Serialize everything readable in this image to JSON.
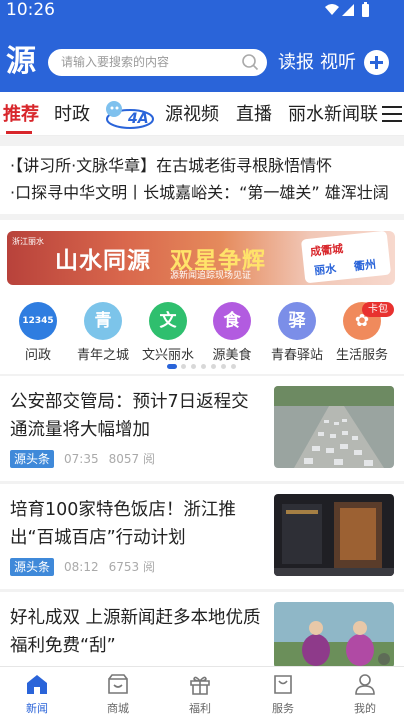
{
  "status_bar": {
    "time": "10:26"
  },
  "header": {
    "logo_text": "源",
    "search_placeholder": "请输入要搜索的内容",
    "read_label": "读报",
    "watch_label": "视听"
  },
  "tabs": [
    {
      "label": "推荐",
      "active": true
    },
    {
      "label": "时政",
      "active": false
    },
    {
      "label": "源视频",
      "active": false
    },
    {
      "label": "直播",
      "active": false
    },
    {
      "label": "丽水新闻联",
      "active": false
    }
  ],
  "tab_logo_text": "4A",
  "headlines": [
    "·【讲习所·文脉华章】在古城老街寻根脉悟情怀",
    "·口探寻中华文明丨长城嘉峪关：“第一雄关” 雄浑壮阔"
  ],
  "banner": {
    "small_text": "浙江丽水",
    "title_left": "山水同源",
    "title_right": "双星争辉",
    "subtitle": "源新闻追踪现场见证",
    "card_top": "成衢城",
    "card_left": "丽水",
    "card_right": "衢州"
  },
  "service_icons": [
    {
      "label": "问政",
      "glyph": "12345",
      "color": "#2f7de0"
    },
    {
      "label": "青年之城",
      "glyph": "青",
      "color": "#7cc4ea"
    },
    {
      "label": "文兴丽水",
      "glyph": "文",
      "color": "#2fbf6e"
    },
    {
      "label": "源美食",
      "glyph": "食",
      "color": "#b25be0"
    },
    {
      "label": "青春驿站",
      "glyph": "驿",
      "color": "#7b8ee8"
    },
    {
      "label": "生活服务",
      "glyph": "✿",
      "color": "#f08a5c"
    }
  ],
  "service_badge": "卡包",
  "news": [
    {
      "title": "公安部交管局：预计7日返程交通流量将大幅增加",
      "source": "源头条",
      "time": "07:35",
      "views": "8057 阅"
    },
    {
      "title": "培育100家特色饭店！浙江推出“百城百店”行动计划",
      "source": "源头条",
      "time": "08:12",
      "views": "6753 阅"
    },
    {
      "title": "好礼成双 上源新闻赶多本地优质福利免费“刮”",
      "source": "",
      "time": "",
      "views": ""
    }
  ],
  "bottom_nav": [
    {
      "label": "新闻",
      "icon": "home-icon",
      "active": true
    },
    {
      "label": "商城",
      "icon": "shop-icon",
      "active": false
    },
    {
      "label": "福利",
      "icon": "gift-icon",
      "active": false
    },
    {
      "label": "服务",
      "icon": "service-icon",
      "active": false
    },
    {
      "label": "我的",
      "icon": "user-icon",
      "active": false
    }
  ],
  "colors": {
    "primary": "#2a64d9",
    "accent": "#d8262b"
  }
}
